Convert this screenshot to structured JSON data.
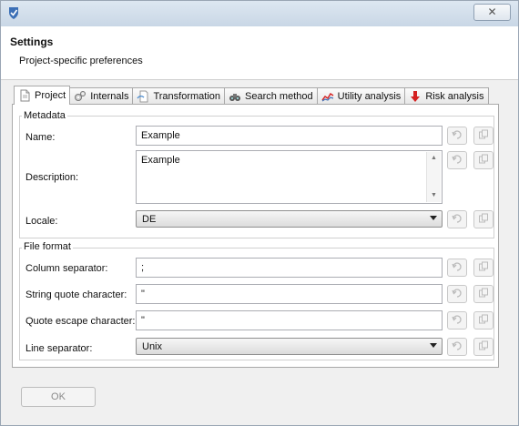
{
  "window": {
    "close_glyph": "✕"
  },
  "header": {
    "title": "Settings",
    "subtitle": "Project-specific preferences"
  },
  "tabs": [
    {
      "label": "Project",
      "icon": "document-icon",
      "active": true
    },
    {
      "label": "Internals",
      "icon": "gears-icon",
      "active": false
    },
    {
      "label": "Transformation",
      "icon": "transform-document-icon",
      "active": false
    },
    {
      "label": "Search method",
      "icon": "binoculars-icon",
      "active": false
    },
    {
      "label": "Utility analysis",
      "icon": "chart-line-icon",
      "active": false
    },
    {
      "label": "Risk analysis",
      "icon": "risk-arrow-icon",
      "active": false
    }
  ],
  "metadata": {
    "legend": "Metadata",
    "name_label": "Name:",
    "name_value": "Example",
    "description_label": "Description:",
    "description_value": "Example",
    "locale_label": "Locale:",
    "locale_value": "DE"
  },
  "file_format": {
    "legend": "File format",
    "column_sep_label": "Column separator:",
    "column_sep_value": ";",
    "quote_label": "String quote character:",
    "quote_value": "\"",
    "escape_label": "Quote escape character:",
    "escape_value": "\"",
    "line_sep_label": "Line separator:",
    "line_sep_value": "Unix"
  },
  "buttons": {
    "ok": "OK"
  },
  "colors": {
    "title_bar": "#c9d7e6",
    "accent_blue": "#3b6fb6",
    "risk_red": "#d42020"
  }
}
